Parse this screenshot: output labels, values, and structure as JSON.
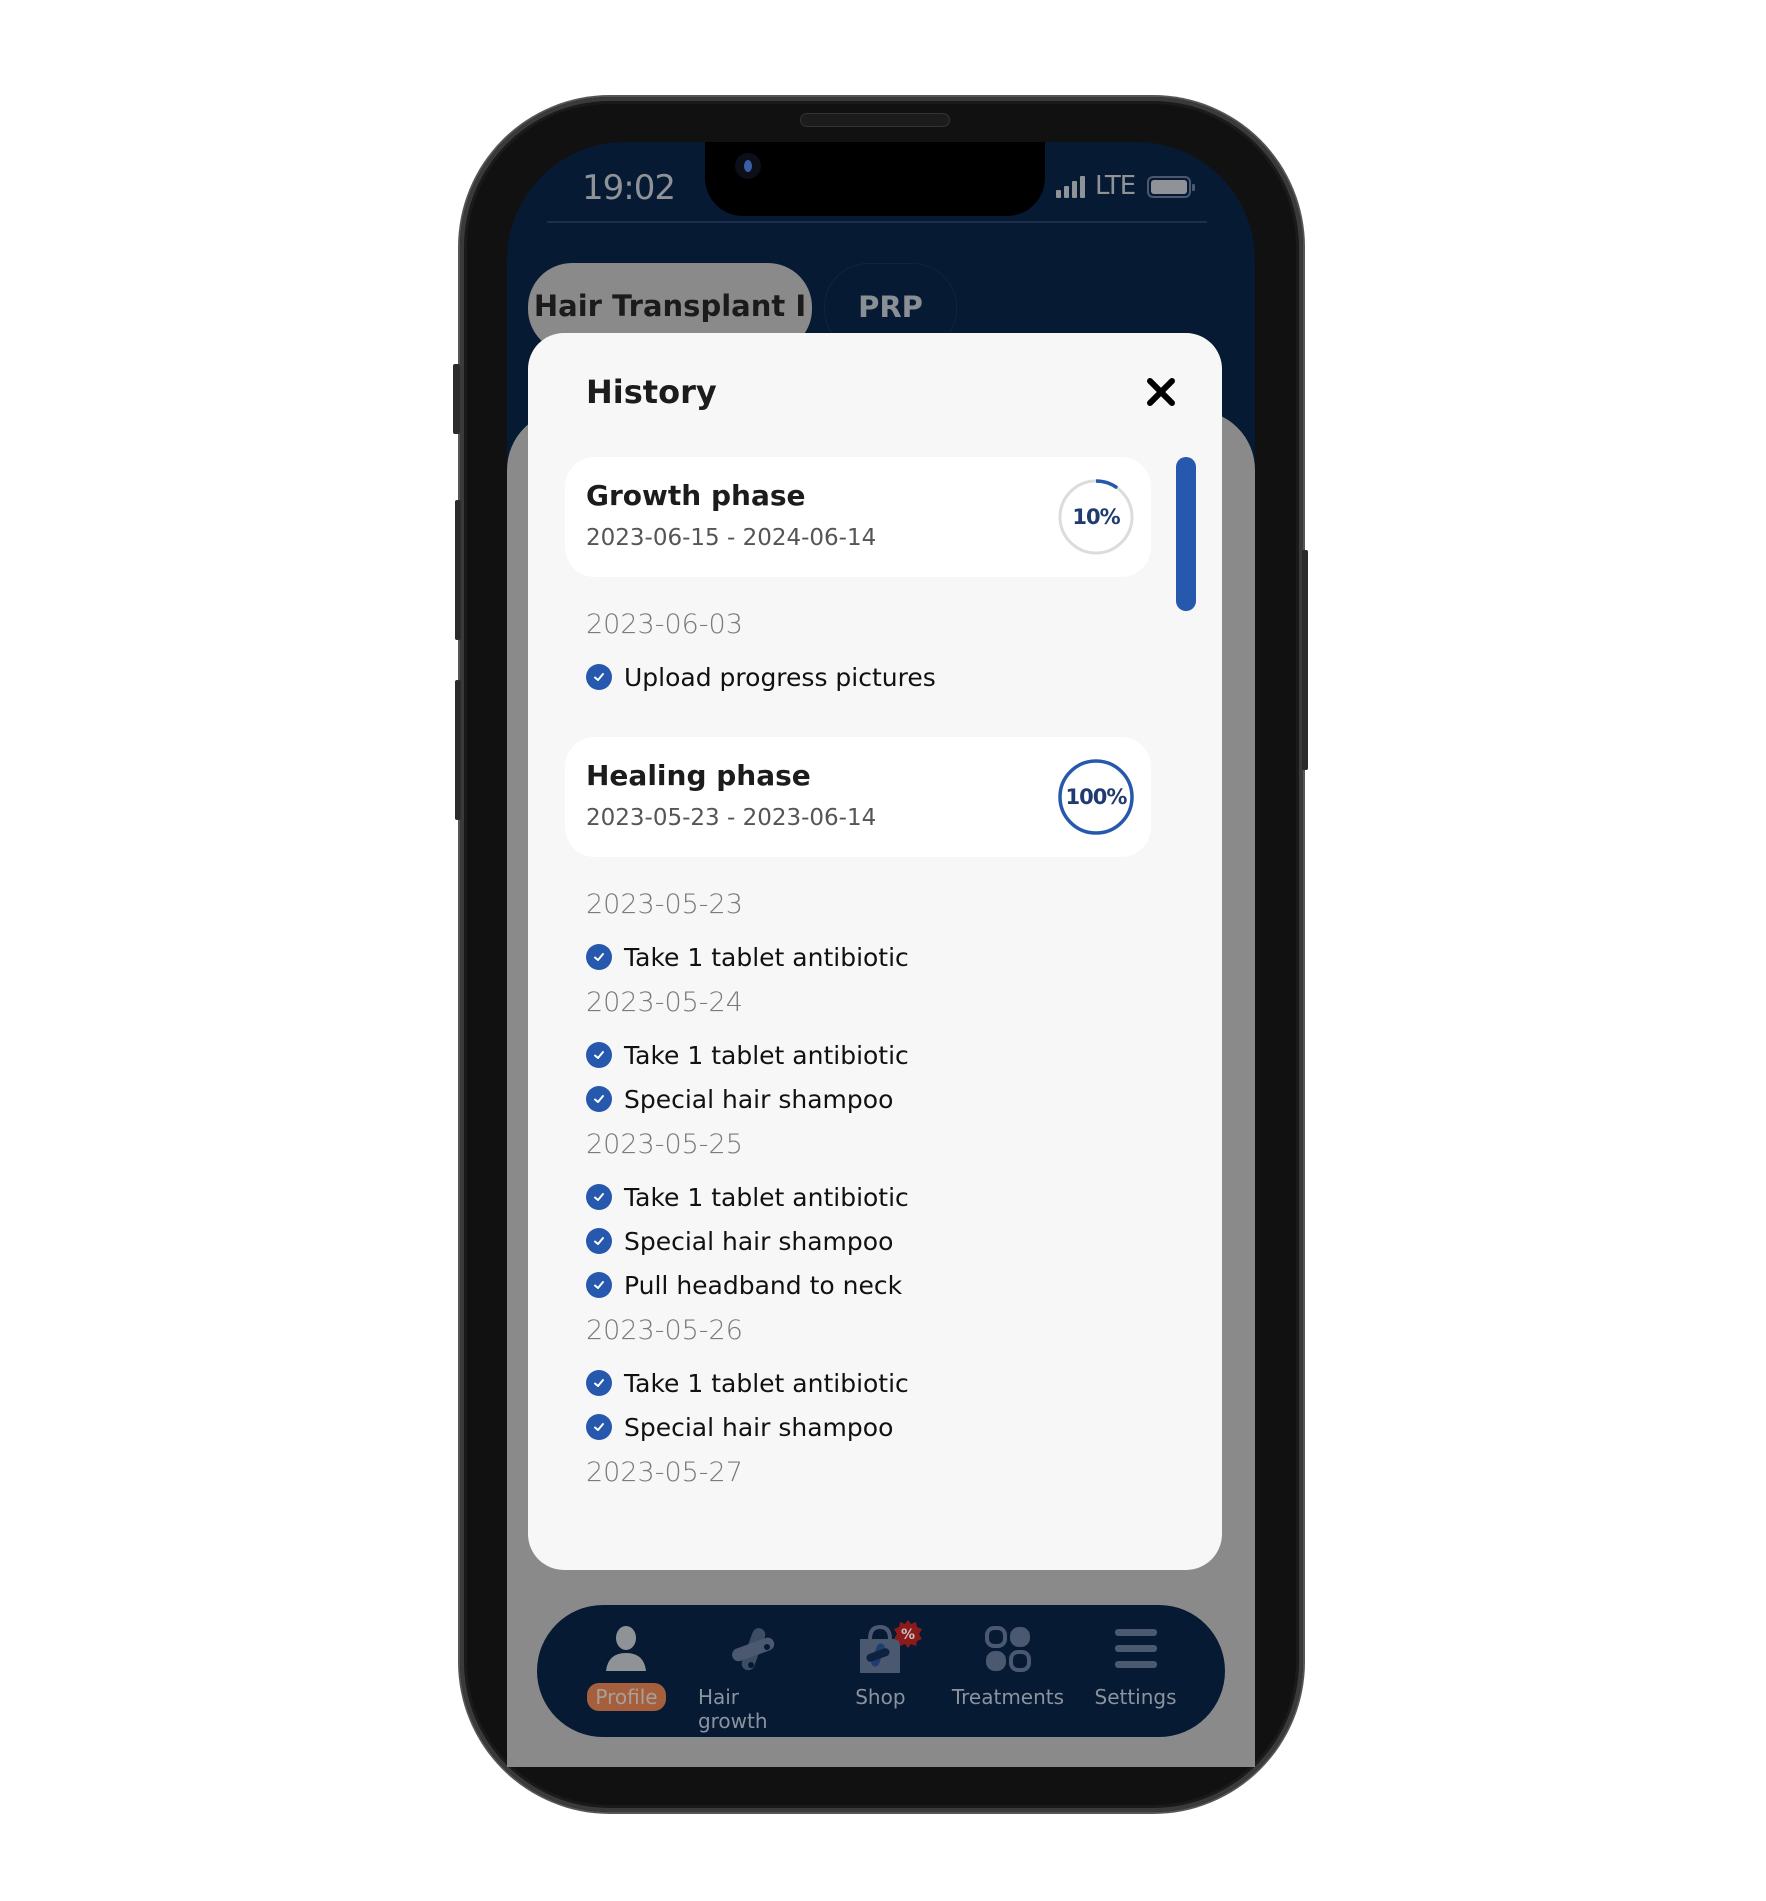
{
  "status_bar": {
    "time": "19:02",
    "network": "LTE"
  },
  "tabs": [
    {
      "label": "Hair Transplant I",
      "active": true
    },
    {
      "label": "PRP",
      "active": false
    }
  ],
  "modal": {
    "title": "History",
    "close_icon": "close-icon",
    "sections": [
      {
        "phase": {
          "name": "Growth phase",
          "range": "2023-06-15 - 2024-06-14",
          "progress_percent": 10,
          "progress_label": "10%"
        },
        "days": [
          {
            "date": "2023-06-03",
            "tasks": [
              "Upload progress pictures"
            ]
          }
        ]
      },
      {
        "phase": {
          "name": "Healing phase",
          "range": "2023-05-23 - 2023-06-14",
          "progress_percent": 100,
          "progress_label": "100%"
        },
        "days": [
          {
            "date": "2023-05-23",
            "tasks": [
              "Take 1 tablet antibiotic"
            ]
          },
          {
            "date": "2023-05-24",
            "tasks": [
              "Take 1 tablet antibiotic",
              "Special hair shampoo"
            ]
          },
          {
            "date": "2023-05-25",
            "tasks": [
              "Take 1 tablet antibiotic",
              "Special hair shampoo",
              "Pull headband to neck"
            ]
          },
          {
            "date": "2023-05-26",
            "tasks": [
              "Take 1 tablet antibiotic",
              "Special hair shampoo"
            ]
          },
          {
            "date": "2023-05-27",
            "tasks": []
          }
        ]
      }
    ]
  },
  "nav": {
    "items": [
      {
        "label": "Profile",
        "icon": "person-icon",
        "active": true
      },
      {
        "label": "Hair growth",
        "icon": "hair-growth-icon",
        "active": false
      },
      {
        "label": "Shop",
        "icon": "shop-bag-icon",
        "active": false,
        "badge": "%"
      },
      {
        "label": "Treatments",
        "icon": "grid-icon",
        "active": false
      },
      {
        "label": "Settings",
        "icon": "menu-icon",
        "active": false
      }
    ]
  },
  "colors": {
    "accent": "#2658ad",
    "header_bg": "#071a33",
    "overlay_gray": "#8a8a8a",
    "active_nav": "#a55f3c",
    "badge": "#8b1a1a"
  }
}
